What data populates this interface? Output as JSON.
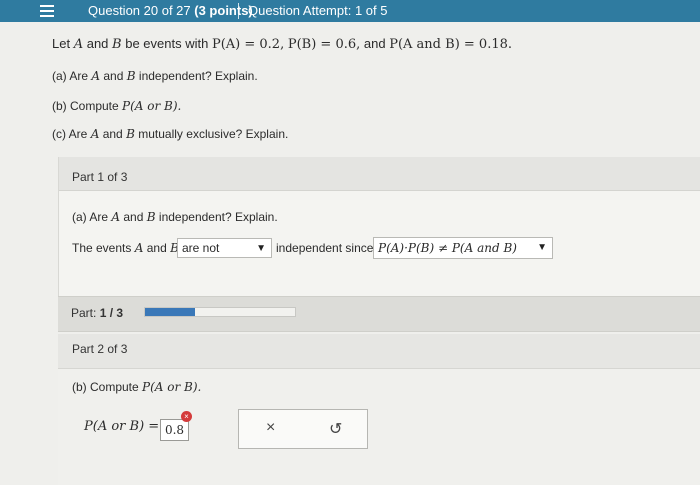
{
  "header": {
    "question_prefix": "Question 20 of 27",
    "points": "(3 points)",
    "attempt": "Question Attempt: 1 of 5"
  },
  "intro": {
    "lead": "Let",
    "A": "A",
    "and": "and",
    "B": "B",
    "rest_text": "be events with",
    "PA": "P(A) = 0.2,",
    "PB": "P(B) = 0.6,",
    "and2": "and",
    "PAB": "P(A and B) = 0.18."
  },
  "items": {
    "a_prefix": "(a) Are",
    "a_A": "A",
    "a_and": "and",
    "a_B": "B",
    "a_suffix": "independent? Explain.",
    "b_prefix": "(b) Compute",
    "b_math": "P(A or B).",
    "c_prefix": "(c) Are",
    "c_A": "A",
    "c_and": "and",
    "c_B": "B",
    "c_suffix": "mutually exclusive? Explain."
  },
  "part1": {
    "label": "Part 1 of 3",
    "question_prefix": "(a) Are",
    "q_A": "A",
    "q_and": "and",
    "q_B": "B",
    "question_suffix": "independent? Explain.",
    "sentence_prefix": "The events",
    "s_A": "A",
    "s_and": "and",
    "s_B": "B",
    "select_value": "are not",
    "sentence_mid": "independent since",
    "reason_select_value": "P(A)·P(B) ≠ P(A and B)"
  },
  "progress": {
    "label": "Part:",
    "value": "1 / 3",
    "fraction": 0.333
  },
  "part2": {
    "label": "Part 2 of 3",
    "question_prefix": "(b) Compute",
    "question_math": "P(A or B).",
    "lhs": "P(A or B) =",
    "answer": "0.8",
    "error_mark": "×",
    "clear_label": "×",
    "undo_label": "↺"
  }
}
